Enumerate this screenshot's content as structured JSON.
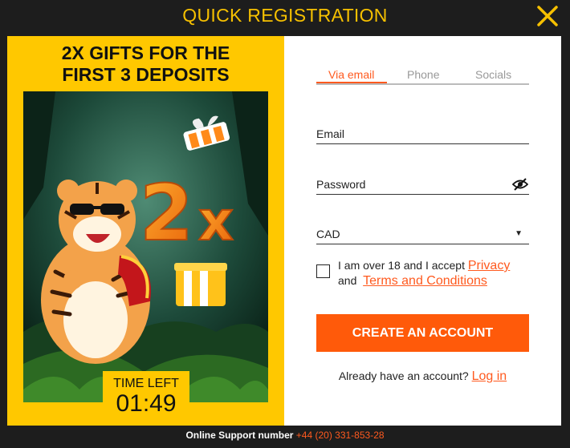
{
  "modal": {
    "title": "QUICK REGISTRATION",
    "close_icon": "close-icon"
  },
  "promo": {
    "headline_line1": "2X GIFTS FOR THE",
    "headline_line2": "FIRST 3 DEPOSITS",
    "art_text": "2x",
    "timer_label": "TIME LEFT",
    "timer_value": "01:49"
  },
  "form": {
    "tabs": [
      {
        "label": "Via email",
        "active": true
      },
      {
        "label": "Phone",
        "active": false
      },
      {
        "label": "Socials",
        "active": false
      }
    ],
    "email_label": "Email",
    "password_label": "Password",
    "password_icon": "eye-slash-icon",
    "currency_value": "CAD",
    "consent_text_1": "I am over 18 and I accept",
    "consent_link_1": "Privacy",
    "consent_text_2": "and",
    "consent_link_2": "Terms and Conditions",
    "create_button": "CREATE AN ACCOUNT",
    "login_prompt": "Already have an account?",
    "login_link": "Log in"
  },
  "footer": {
    "support_label": "Online Support number",
    "support_number": "+44 (20) 331-853-28"
  },
  "colors": {
    "accent": "#ff5a1f",
    "promo_yellow": "#ffc800",
    "title_yellow": "#f6c000"
  }
}
